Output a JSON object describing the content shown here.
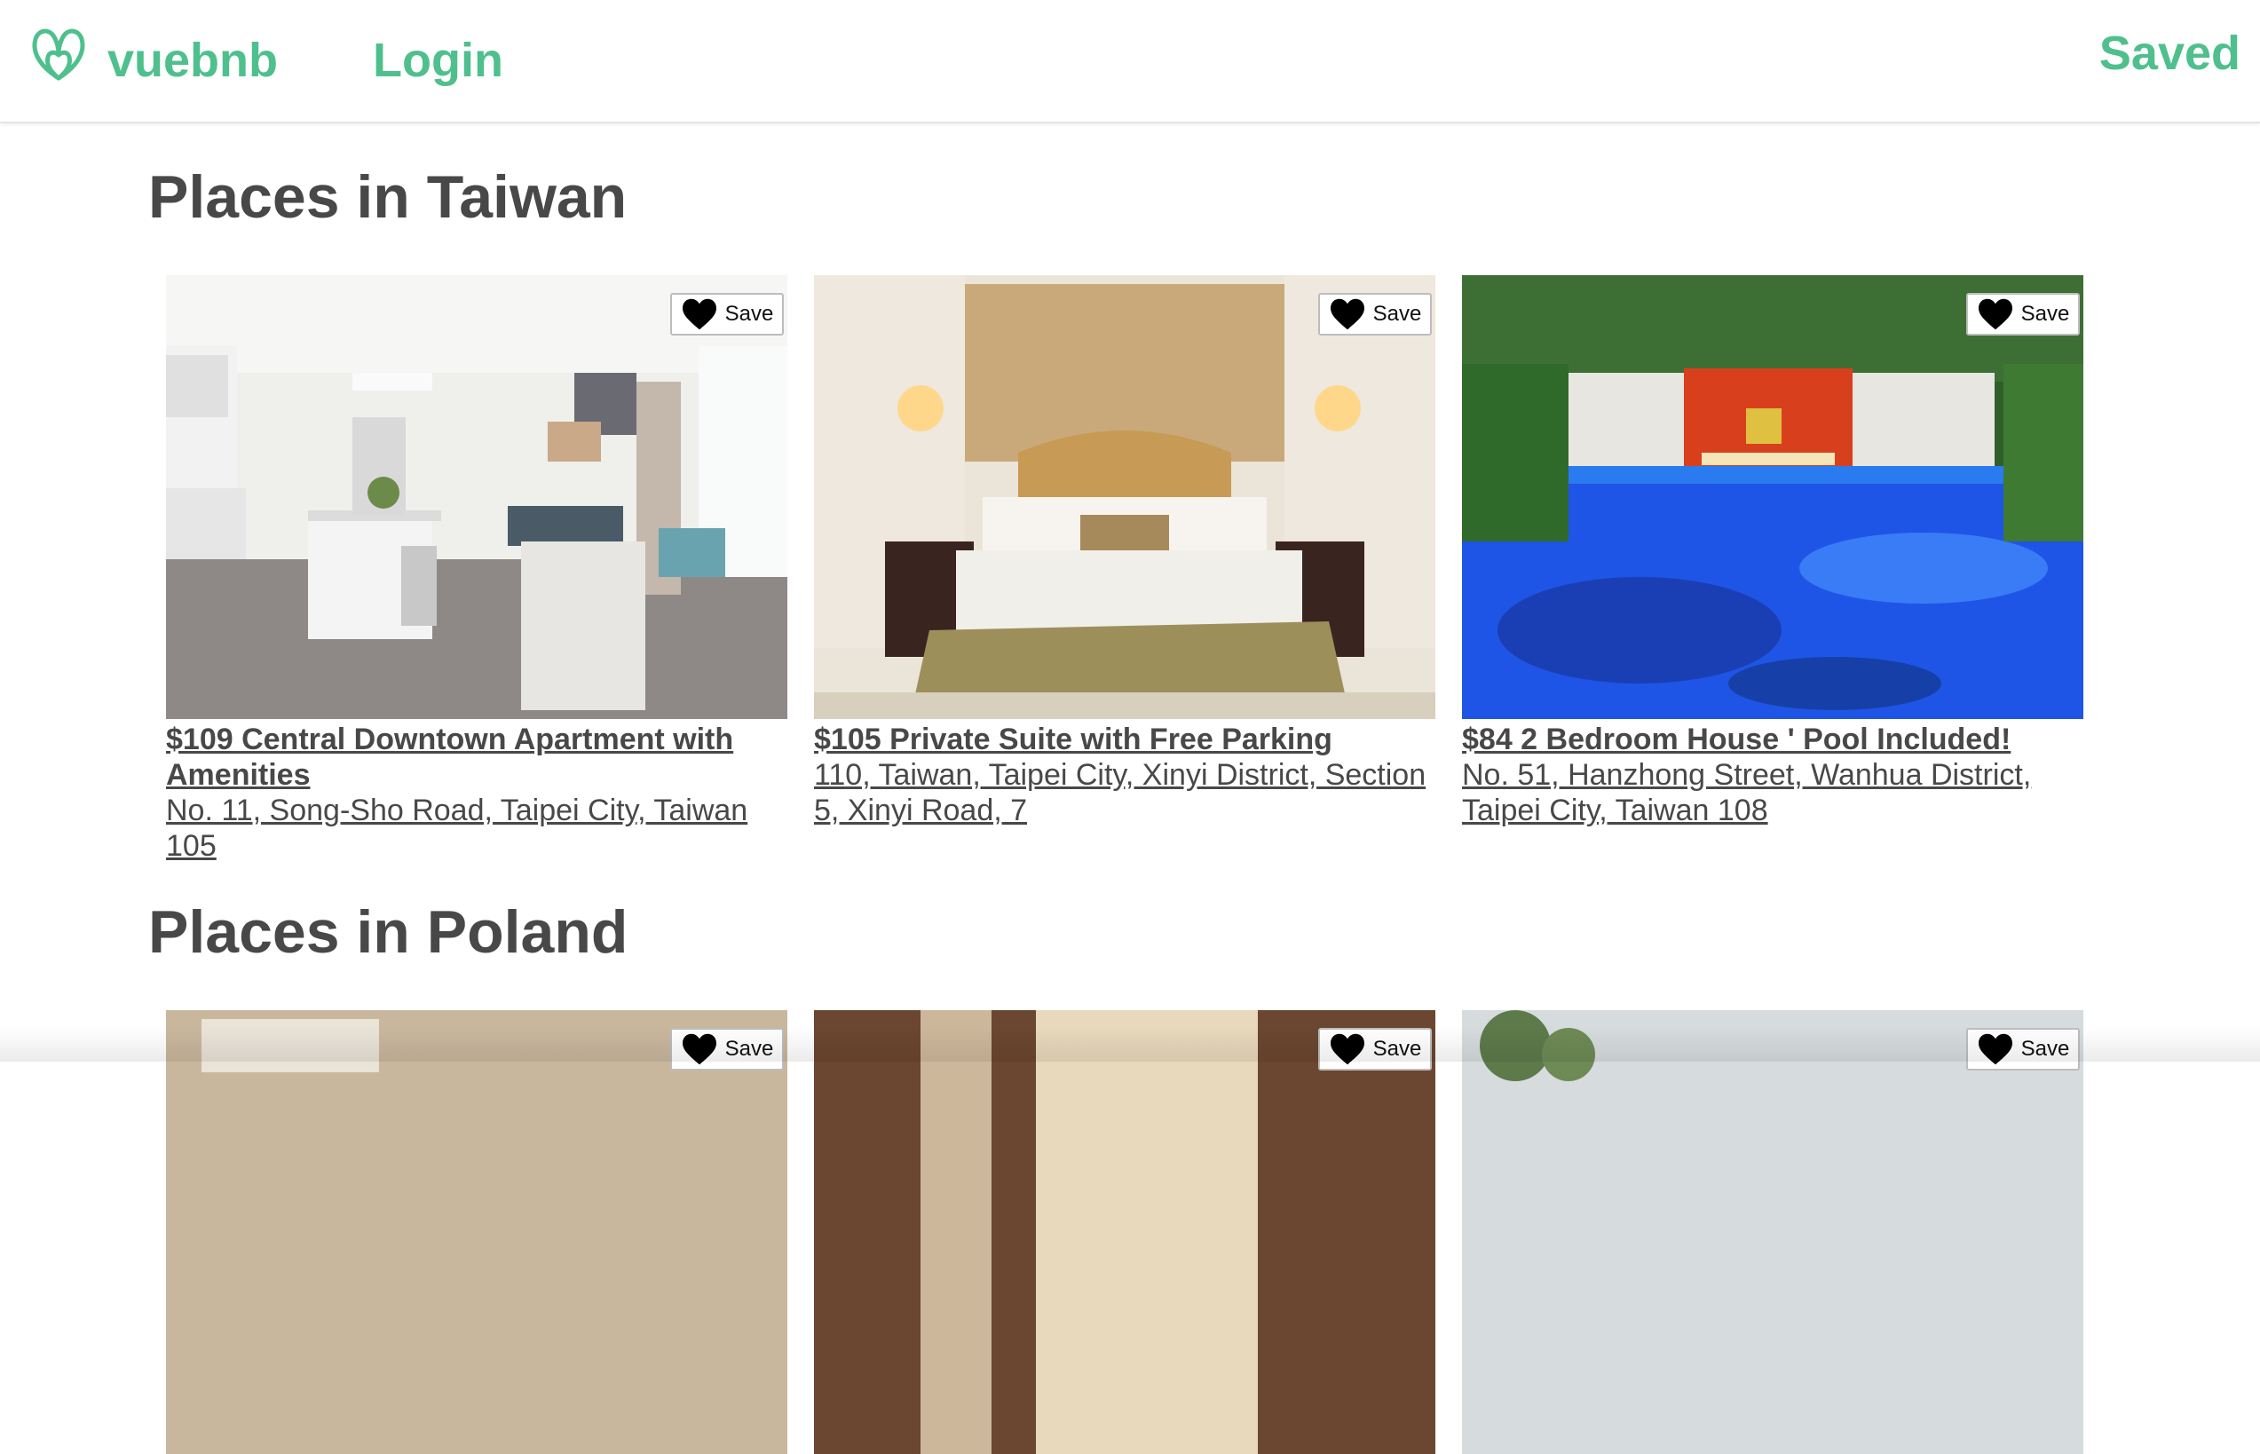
{
  "header": {
    "brand": "vuebnb",
    "login": "Login",
    "saved": "Saved",
    "logo_icon": "vuebnb-logo-icon",
    "accent_color": "#4fc08d"
  },
  "sections": [
    {
      "title": "Places in Taiwan",
      "listings": [
        {
          "title": "$109 Central Downtown Apartment with Amenities",
          "address": "No. 11, Song-Sho Road, Taipei City, Taiwan 105",
          "save_label": "Save",
          "image": "apartment-living-room-photo"
        },
        {
          "title": "$105 Private Suite with Free Parking",
          "address": "110, Taiwan, Taipei City, Xinyi District, Section 5, Xinyi Road, 7",
          "save_label": "Save",
          "image": "hotel-bedroom-photo"
        },
        {
          "title": "$84 2 Bedroom House ' Pool Included!",
          "address": "No. 51, Hanzhong Street, Wanhua District, Taipei City, Taiwan 108",
          "save_label": "Save",
          "image": "swimming-pool-photo"
        }
      ]
    },
    {
      "title": "Places in Poland",
      "listings": [
        {
          "save_label": "Save",
          "image": "bedroom-photo"
        },
        {
          "save_label": "Save",
          "image": "curtained-bed-photo"
        },
        {
          "save_label": "Save",
          "image": "outdoor-trees-photo"
        }
      ]
    }
  ]
}
